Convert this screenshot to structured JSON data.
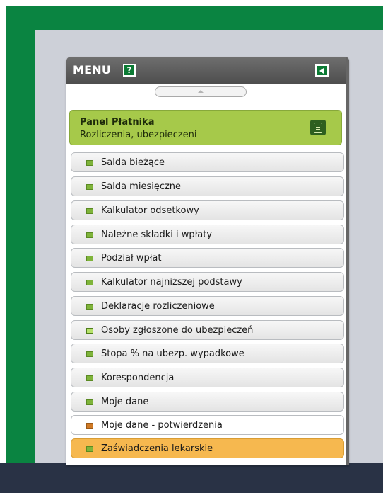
{
  "menu": {
    "title": "MENU",
    "help_icon_text": "?",
    "panel": {
      "title": "Panel Płatnika",
      "subtitle": "Rozliczenia, ubezpieczeni"
    },
    "items": [
      {
        "label": "Salda bieżące",
        "state": "normal"
      },
      {
        "label": "Salda miesięczne",
        "state": "normal"
      },
      {
        "label": "Kalkulator odsetkowy",
        "state": "normal"
      },
      {
        "label": "Należne składki i wpłaty",
        "state": "normal"
      },
      {
        "label": "Podział wpłat",
        "state": "normal"
      },
      {
        "label": "Kalkulator najniższej podstawy",
        "state": "normal"
      },
      {
        "label": "Deklaracje rozliczeniowe",
        "state": "normal"
      },
      {
        "label": "Osoby zgłoszone do ubezpieczeń",
        "state": "normal"
      },
      {
        "label": "Stopa % na ubezp. wypadkowe",
        "state": "normal"
      },
      {
        "label": "Korespondencja",
        "state": "normal"
      },
      {
        "label": "Moje dane",
        "state": "normal"
      },
      {
        "label": "Moje dane - potwierdzenia",
        "state": "hover"
      },
      {
        "label": "Zaświadczenia lekarskie",
        "state": "selected"
      }
    ]
  },
  "colors": {
    "outer_green": "#0a8441",
    "panel_green": "#a6c94a",
    "selected_orange": "#f6b84f",
    "header_gray": "#5a5a5a"
  }
}
